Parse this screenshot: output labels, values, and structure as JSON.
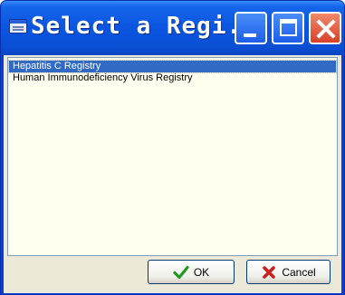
{
  "window": {
    "title": "Select a Regi...",
    "app_icon": "registry-app-icon",
    "controls": {
      "minimize": "minimize-icon",
      "maximize": "maximize-icon",
      "close": "close-icon"
    }
  },
  "list": {
    "items": [
      {
        "label": "Hepatitis C Registry",
        "selected": true
      },
      {
        "label": "Human Immunodeficiency Virus Registry",
        "selected": false
      }
    ]
  },
  "buttons": {
    "ok_label": "OK",
    "ok_icon": "check-icon",
    "cancel_label": "Cancel",
    "cancel_icon": "x-icon"
  },
  "colors": {
    "title_bar": "#0b55e0",
    "selection": "#316ac5",
    "list_background": "#fffff0",
    "dialog_face": "#ece9d8",
    "check_green": "#1f9a1f",
    "cancel_red": "#c8201e"
  }
}
